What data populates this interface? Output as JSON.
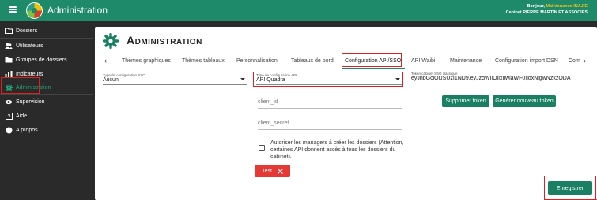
{
  "header": {
    "app_title": "Administration",
    "greeting": "Bonjour,",
    "user_name": "Maintenance INAJIE",
    "company": "Cabinet PIERRE MARTIN ET ASSOCIES"
  },
  "sidebar": {
    "items": [
      {
        "label": "Dossiers",
        "icon": "folder-icon"
      },
      {
        "label": "Utilisateurs",
        "icon": "users-icon"
      },
      {
        "label": "Groupes de dossiers",
        "icon": "folder-group-icon"
      },
      {
        "label": "Indicateurs",
        "icon": "chart-icon"
      },
      {
        "label": "Administration",
        "icon": "gear-icon"
      },
      {
        "label": "Supervision",
        "icon": "eye-icon"
      },
      {
        "label": "Aide",
        "icon": "help-icon"
      },
      {
        "label": "A propos",
        "icon": "info-icon"
      }
    ]
  },
  "page": {
    "title": "Administration"
  },
  "tabs": [
    {
      "label": "Thèmes graphiques"
    },
    {
      "label": "Thèmes tableaux"
    },
    {
      "label": "Personnalisation"
    },
    {
      "label": "Tableaux de bord"
    },
    {
      "label": "Configuration API/SSO",
      "active": true
    },
    {
      "label": "API Waibi"
    },
    {
      "label": "Maintenance"
    },
    {
      "label": "Configuration import DSN"
    },
    {
      "label": "Com"
    }
  ],
  "form": {
    "sso_type": {
      "label": "Type de configuration SSO",
      "value": "Aucun"
    },
    "api_type": {
      "label": "Type de configuration API",
      "value": "API Quadra"
    },
    "token": {
      "label": "Token cabinet SSO classique",
      "value": "eyJhbGciOiJSUzI1NiJ9.eyJzdWIiOiIxIiwiaWF0IjoxNjgwNzkzODA"
    },
    "client_id_placeholder": "client_id",
    "client_secret_placeholder": "client_secret",
    "checkbox_text": "Autoriser les managers à créer les dossiers (Attention, certaines API donnent accès à tous les dossiers du cabinet).",
    "delete_token_label": "Supprimer token",
    "generate_token_label": "Générer nouveau token",
    "test_label": "Test",
    "save_label": "Enregistrer"
  },
  "colors": {
    "brand": "#1e8a6a",
    "button_green": "#1a7f63",
    "danger": "#e53935",
    "highlight": "#e02020"
  }
}
